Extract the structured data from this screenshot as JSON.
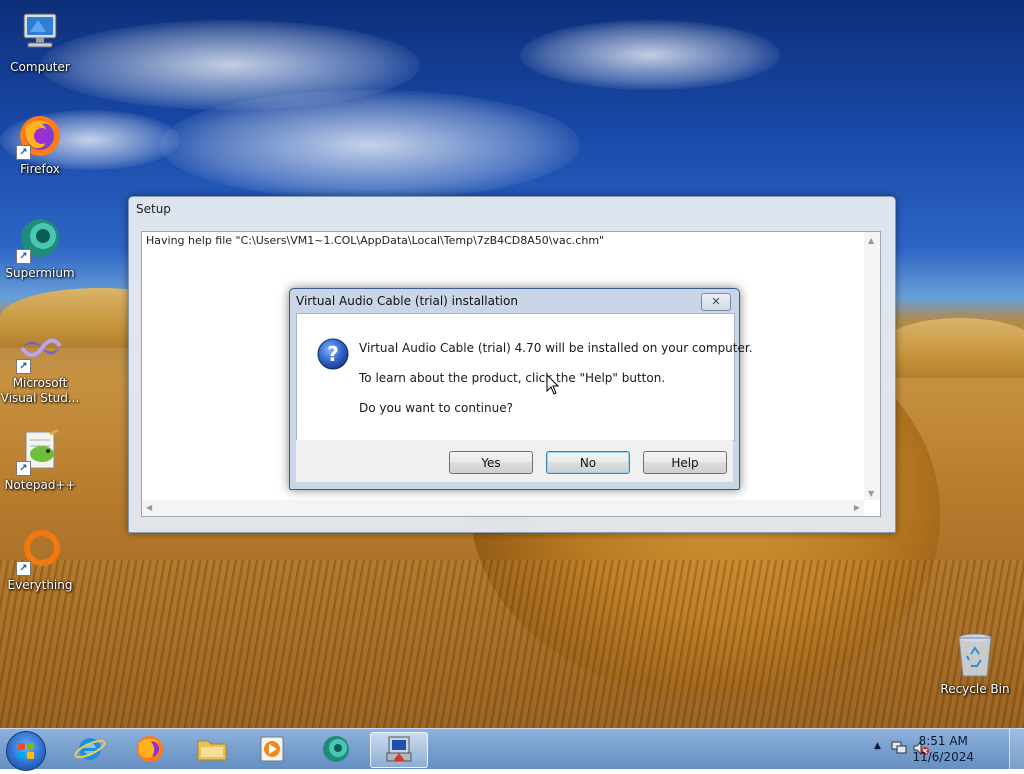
{
  "desktop_icons": [
    {
      "label": "Computer",
      "icon": "computer-icon"
    },
    {
      "label": "Firefox",
      "icon": "firefox-icon"
    },
    {
      "label": "Supermium",
      "icon": "supermium-icon"
    },
    {
      "label_line1": "Microsoft",
      "label_line2": "Visual Stud...",
      "icon": "visual-studio-icon"
    },
    {
      "label": "Notepad++",
      "icon": "notepadpp-icon"
    },
    {
      "label": "Everything",
      "icon": "everything-icon"
    },
    {
      "label": "Recycle Bin",
      "icon": "recycle-bin-icon"
    }
  ],
  "setup_window": {
    "title": "Setup",
    "log_text": "Having help file \"C:\\Users\\VM1~1.COL\\AppData\\Local\\Temp\\7zB4CD8A50\\vac.chm\""
  },
  "dialog": {
    "title": "Virtual Audio Cable (trial) installation",
    "close_glyph": "✕",
    "message_line1": "Virtual Audio Cable (trial) 4.70 will be installed on your computer.",
    "message_line2": "To learn about the product, click the \"Help\" button.",
    "message_line3": "Do you want to continue?",
    "buttons": {
      "yes": "Yes",
      "no": "No",
      "help": "Help"
    },
    "default_button": "No"
  },
  "taskbar": {
    "items": [
      "start-orb-icon",
      "internet-explorer-icon",
      "firefox-icon",
      "file-explorer-icon",
      "media-player-icon",
      "supermium-icon",
      "setup-icon"
    ],
    "clock_time": "8:51 AM",
    "clock_date": "11/6/2024",
    "tray_up_arrow": "▲"
  },
  "colors": {
    "taskbar": "#7aa1cf",
    "dialog_frame": "#c9d6e8",
    "window_frame": "#e2e8f0"
  }
}
